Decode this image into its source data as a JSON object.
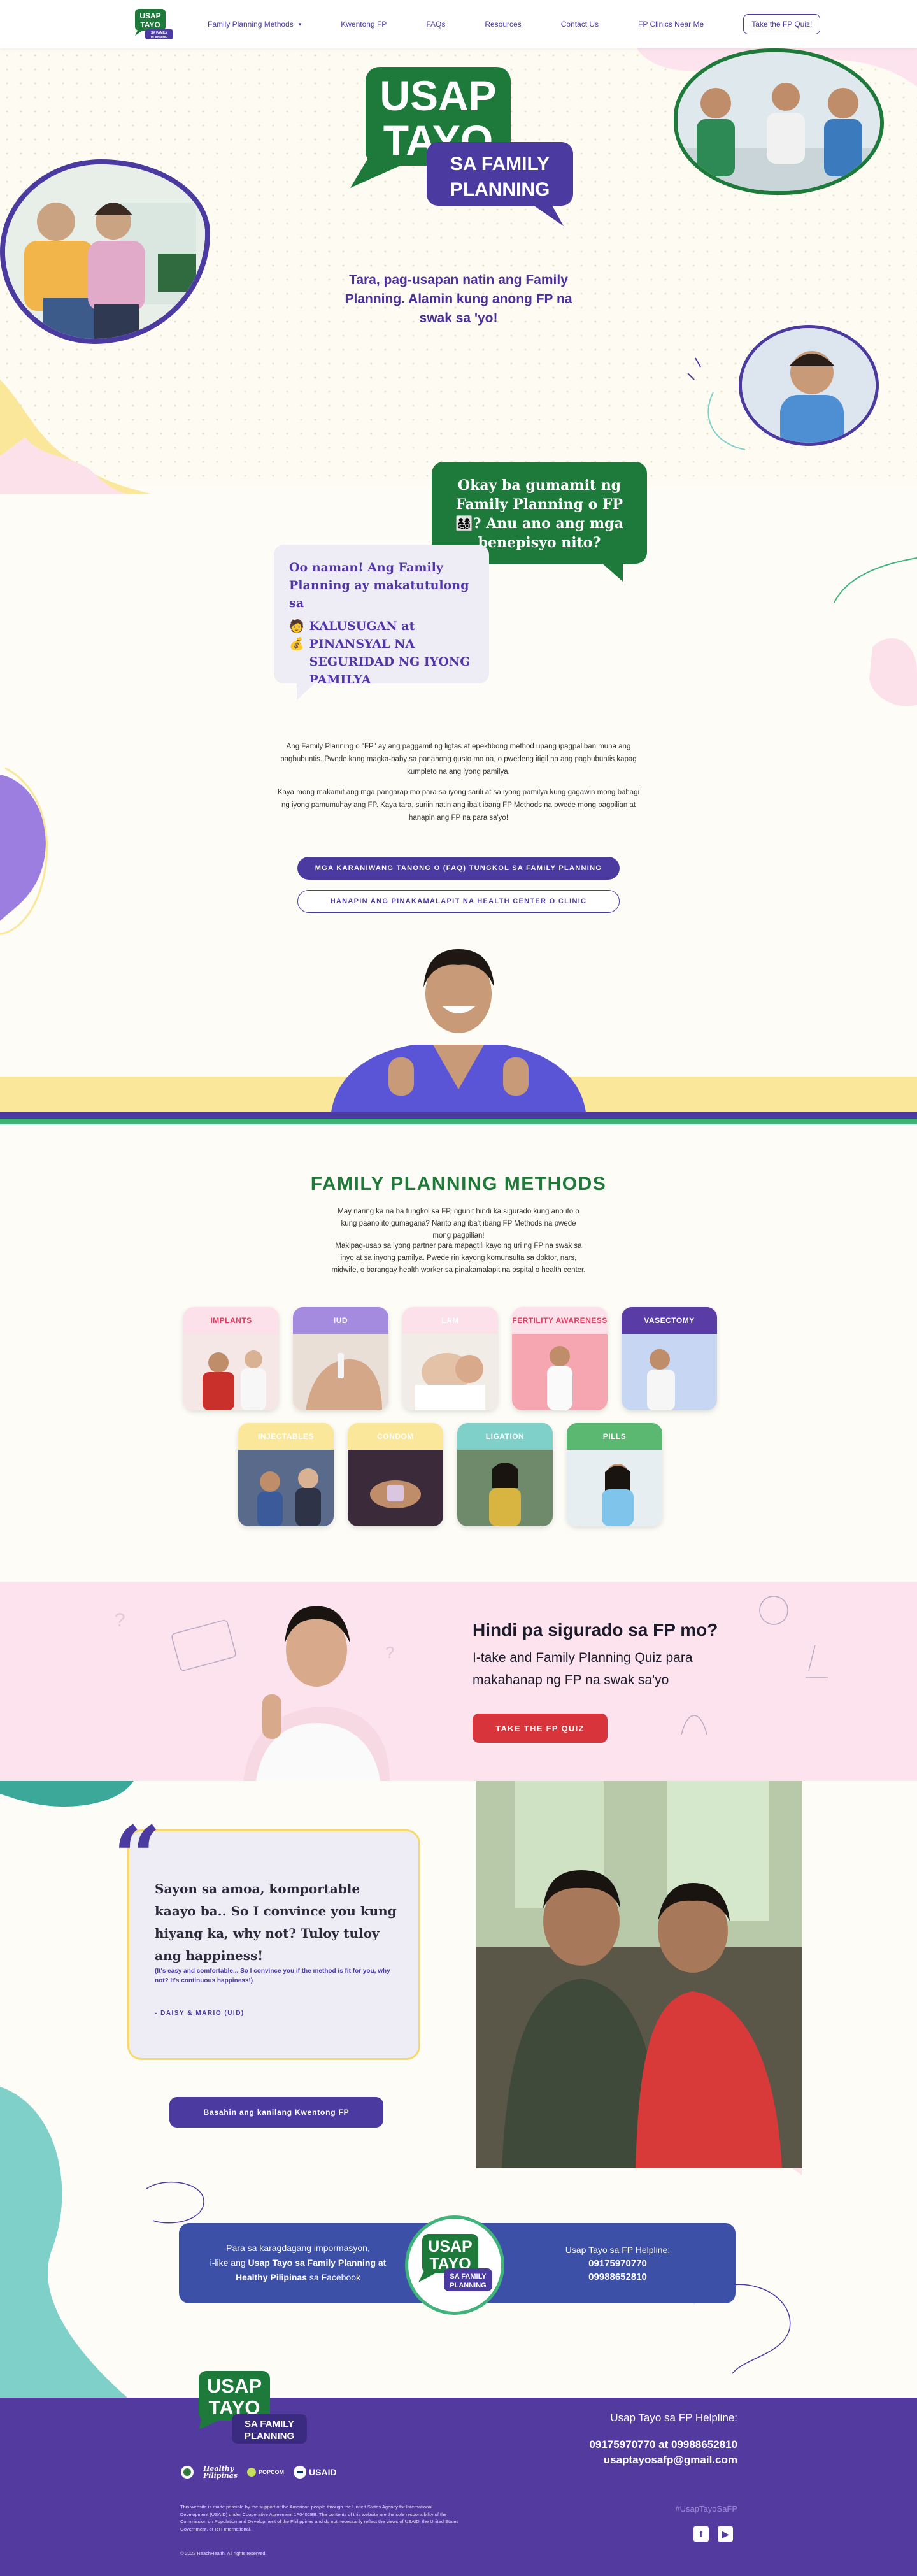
{
  "nav": {
    "items": [
      "Family Planning Methods",
      "Kwentong FP",
      "FAQs",
      "Resources",
      "Contact Us",
      "FP Clinics Near Me"
    ],
    "quiz": "Take the FP Quiz!"
  },
  "logo": {
    "l1": "USAP",
    "l2": "TAYO",
    "l3": "SA FAMILY",
    "l4": "PLANNING"
  },
  "hero": {
    "tagline": "Tara, pag-usapan natin ang Family Planning. Alamin kung anong FP na swak sa 'yo!"
  },
  "chat": {
    "question": "Okay ba gumamit ng Family Planning o FP 👨‍👩‍👧‍👦? Anu ano ang mga benepisyo nito?",
    "answer_intro": "Oo naman! Ang Family Planning ay makatutulong sa",
    "answer_health": "KALUSUGAN at",
    "answer_finance": "PINANSYAL NA SEGURIDAD NG IYONG PAMILYA",
    "emoji_health": "🧑",
    "emoji_finance": "💰"
  },
  "intro": {
    "p1": "Ang Family Planning o \"FP\" ay ang paggamit ng ligtas at epektibong method upang ipagpaliban muna ang pagbubuntis. Pwede kang magka-baby sa panahong gusto mo na, o pwedeng itigil na ang pagbubuntis kapag kumpleto na ang iyong pamilya.",
    "p2": "Kaya mong makamit ang mga pangarap mo para sa iyong sarili at sa iyong pamilya kung gagawin mong bahagi ng iyong pamumuhay ang FP. Kaya tara, suriin natin ang iba't ibang FP Methods na pwede mong pagpilian at hanapin ang FP na para sa'yo!",
    "btn_faq": "MGA KARANIWANG TANONG O (FAQ) TUNGKOL SA FAMILY PLANNING",
    "btn_clinic": "HANAPIN ANG PINAKAMALAPIT NA HEALTH CENTER O CLINIC"
  },
  "methods": {
    "title": "FAMILY PLANNING METHODS",
    "sub1": "May naring ka na ba tungkol sa FP, ngunit hindi ka sigurado kung ano ito o kung paano ito gumagana? Narito ang iba't ibang FP Methods na pwede mong pagpilian!",
    "sub2": "Makipag-usap sa iyong partner para mapagtili kayo ng uri ng FP na swak sa inyo at sa inyong pamilya. Pwede rin kayong komunsulta sa doktor, nars, midwife, o barangay health worker sa pinakamalapit na ospital o health center.",
    "cards": [
      {
        "label": "IMPLANTS",
        "bg": "#fde1ea",
        "fg": "#e03a5e"
      },
      {
        "label": "IUD",
        "bg": "#a58be0",
        "fg": "#ffffff"
      },
      {
        "label": "LAM",
        "bg": "#fde1ea",
        "fg": "#ffffff"
      },
      {
        "label": "FERTILITY AWARENESS",
        "bg": "#fde1ea",
        "fg": "#e03a5e"
      },
      {
        "label": "VASECTOMY",
        "bg": "#5a3ca6",
        "fg": "#ffffff"
      },
      {
        "label": "INJECTABLES",
        "bg": "#fbe79a",
        "fg": "#ffffff"
      },
      {
        "label": "CONDOM",
        "bg": "#fbe79a",
        "fg": "#ffffff"
      },
      {
        "label": "LIGATION",
        "bg": "#7fd0c8",
        "fg": "#ffffff"
      },
      {
        "label": "PILLS",
        "bg": "#5ab870",
        "fg": "#ffffff"
      }
    ]
  },
  "quiz": {
    "title": "Hindi pa sigurado sa FP mo?",
    "text": "I-take and Family Planning Quiz para makahanap ng FP na swak sa'yo",
    "btn": "TAKE THE FP QUIZ"
  },
  "testimonial": {
    "quote": "Sayon sa amoa, komportable kaayo ba.. So I convince you kung hiyang ka, why not? Tuloy tuloy ang happiness!",
    "english": "(It's easy and comfortable... So I convince you if the method is fit for you, why not? It's continuous happiness!)",
    "name": "- DAISY & MARIO (UID)",
    "btn": "Basahin ang kanilang Kwentong FP"
  },
  "facebook": {
    "line1": "Para sa karagdagang impormasyon,",
    "line2a": "i-like ang ",
    "line2b": "Usap Tayo sa Family Planning at",
    "line3b": "Healthy Pilipinas",
    "line3c": " sa Facebook",
    "helpline": "Usap Tayo sa FP Helpline:",
    "phone1": "09175970770",
    "phone2": "09988652810"
  },
  "footer": {
    "helpline": "Usap Tayo sa FP Helpline:",
    "phones": "09175970770 at 09988652810",
    "email": "usaptayosafp@gmail.com",
    "hashtag": "#UsapTayoSaFP",
    "social": [
      "f",
      "▶"
    ],
    "logos": [
      "Healthy Pilipinas",
      "POPCOM",
      "USAID"
    ],
    "disclaimer": "This website is made possible by the support of the American people through the United States Agency for International Development (USAID) under Cooperative Agreement 1F0402BB. The contents of this website are the sole responsibility of the Commission on Population and Development of the Philippines and do not necessarily reflect the views of USAID, the United States Government, or RTI International.",
    "copyright": "© 2022 ReachHealth. All rights reserved."
  },
  "colors": {
    "purple": "#4b3aa0",
    "green": "#1e7a3a",
    "yellow": "#fbe79a",
    "pink": "#fde3ee",
    "red": "#d8343b"
  }
}
